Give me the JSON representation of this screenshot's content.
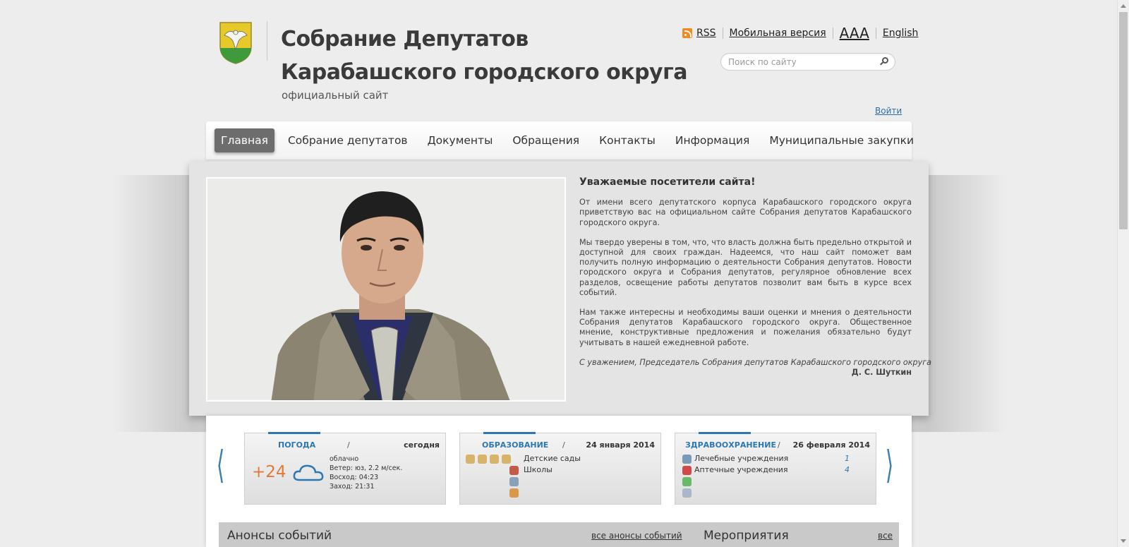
{
  "header": {
    "title_line1": "Собрание Депутатов",
    "title_line2": "Карабашского городского округа",
    "subtitle": "официальный сайт",
    "logo_icon": "coat-of-arms-icon"
  },
  "toplinks": {
    "rss": "RSS",
    "mobile": "Мобильная версия",
    "font_size": "AAA",
    "english": "English"
  },
  "search": {
    "placeholder": "Поиск по сайту"
  },
  "login": "Войти",
  "nav": {
    "items": [
      {
        "label": "Главная",
        "active": true
      },
      {
        "label": "Собрание депутатов"
      },
      {
        "label": "Документы"
      },
      {
        "label": "Обращения"
      },
      {
        "label": "Контакты"
      },
      {
        "label": "Информация"
      },
      {
        "label": "Муниципальные закупки"
      }
    ]
  },
  "hero": {
    "heading": "Уважаемые посетители сайта!",
    "p1": "От имени всего депутатского корпуса Карабашского городского округа приветствую вас на официальном сайте Собрания депутатов Карабашского городского округа.",
    "p2": "Мы твердо уверены в том, что, что власть должна быть предельно открытой и доступной для своих граждан. Надеемся, что наш сайт поможет вам получить полную информацию о деятельности Собрания депутатов. Новости городского округа и Собрания депутатов, регулярное обновление всех разделов, освещение работы депутатов позволит вам быть в курсе всех событий.",
    "p3": "Нам также интересны и необходимы ваши оценки и мнения о деятельности Собрания депутатов Карабашского городского округа. Общественное мнение, конструктивные предложения и пожелания обязательно будут учитывать в нашей ежедневной работе.",
    "signature": "С уважением, Председатель Собрания депутатов Карабашского городского округа",
    "signature_name": "Д. С. Шуткин"
  },
  "widgets": {
    "weather": {
      "category": "ПОГОДА",
      "slash": "/",
      "date": "сегодня",
      "temperature": "+24",
      "condition": "облачно",
      "wind": "Ветер: юз, 2.2 м/сек.",
      "sunrise": "Восход: 04:23",
      "sunset": "Заход: 21:31",
      "icon": "cloud-icon"
    },
    "education": {
      "category": "ОБРАЗОВАНИЕ",
      "slash": "/",
      "date": "24 января 2014",
      "items": [
        "Детские сады",
        "Школы"
      ]
    },
    "health": {
      "category": "ЗДРАВООХРАНЕНИЕ",
      "slash": "/",
      "date": "26 февраля 2014",
      "items": [
        {
          "label": "Лечебные учреждения",
          "count": "1"
        },
        {
          "label": "Аптечные учреждения",
          "count": "4"
        }
      ]
    }
  },
  "sections": {
    "announcements_title": "Анонсы событий",
    "announcements_link": "все анонсы событий",
    "events_title": "Мероприятия",
    "events_link": "все"
  },
  "colors": {
    "accent": "#2d77b3",
    "temperature": "#e07a3a",
    "nav_active": "#6d6d6d"
  }
}
